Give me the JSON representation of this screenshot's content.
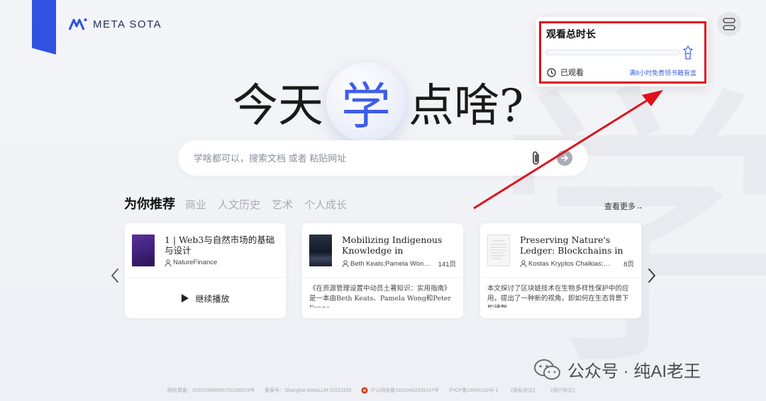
{
  "brand": {
    "name": "META SOTA"
  },
  "headline": {
    "prefix": "今天",
    "accent": "学",
    "suffix": "点啥?"
  },
  "background_glyph": "学",
  "search": {
    "placeholder": "学啥都可以，搜索文档 或者 粘贴网址"
  },
  "recommend": {
    "title": "为你推荐",
    "tabs": [
      "商业",
      "人文历史",
      "艺术",
      "个人成长"
    ],
    "more_label": "查看更多→",
    "cards": [
      {
        "title": "1 | Web3与自然市场的基础与设计",
        "author": "NatureFinance",
        "pages": "",
        "action_label": "继续播放",
        "thumb_color": "#3a1f6e"
      },
      {
        "title": "Mobilizing Indigenous Knowledge in Resource…",
        "author": "Beth Keats;Pamela Won…",
        "pages": "141页",
        "description": "《在资源管理设置中动员土著知识：实用指南》是一本由Beth Keats、Pamela Wong和Peter Evans…",
        "thumb_color": "#1d2433"
      },
      {
        "title": "Preserving Nature's Ledger: Blockchains in Biodiversi…",
        "author": "Kostas Kryptos Chalkias;…",
        "pages": "8页",
        "description": "本文探讨了区块链技术在生物多样性保护中的应用，提出了一种新的视角，即如何在生态背景下构建数…",
        "thumb_color": "#f3f3f3"
      }
    ]
  },
  "watch_time": {
    "title": "观看总时长",
    "progress": 0,
    "watched_label": "已观看",
    "reward_link": "满8小时免费领书籍盲盒"
  },
  "footer": {
    "items": [
      "网信算备：310115866995701230019号",
      "备案号：Shanghai-MetaLLM-20231106",
      "沪公网安备31010402335147号",
      "沪ICP备18046118号-1",
      "《隐私协议》",
      "《用户协议》"
    ]
  },
  "watermark": {
    "text": "公众号 · 纯AI老王"
  },
  "colors": {
    "accent": "#3d5ee6",
    "ribbon": "#2f52e0",
    "annotation": "#e0101b"
  }
}
